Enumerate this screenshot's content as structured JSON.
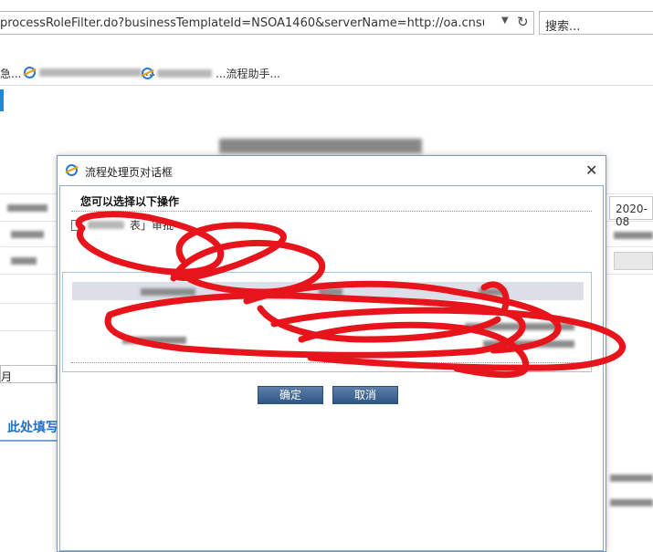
{
  "browser": {
    "url": "processRoleFilter.do?businessTemplateId=NSOA1460&serverName=http://oa.cnsuning.com&",
    "search_placeholder": "搜索...",
    "favorites": [
      {
        "label": "急..."
      },
      {
        "label": "..."
      },
      {
        "label": "...流程助手..."
      }
    ]
  },
  "background_page": {
    "date_value": "2020-08",
    "month_label": "月",
    "section_heading": "此处填写"
  },
  "dialog": {
    "title": "流程处理页对话框",
    "prompt": "您可以选择以下操作",
    "option_label": "表」审批",
    "ok_label": "确定",
    "cancel_label": "取消",
    "close_glyph": "✕"
  },
  "colors": {
    "accent": "#2271c7",
    "button": "#3c628f",
    "scribble": "#e8141c"
  }
}
